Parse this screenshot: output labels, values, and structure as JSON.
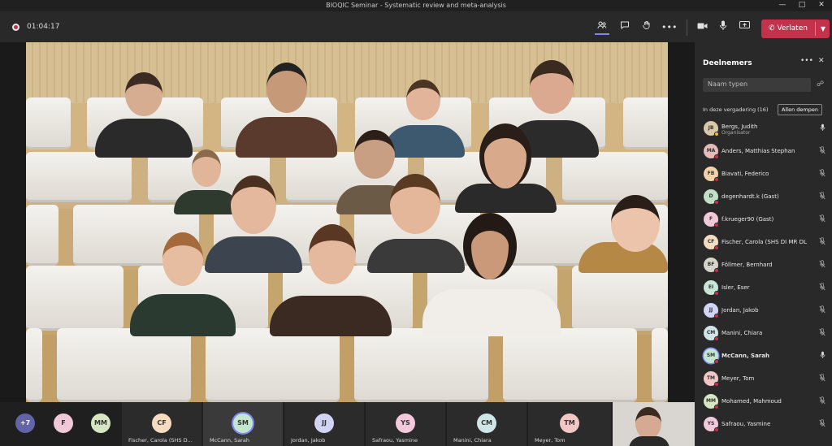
{
  "window": {
    "title": "BIOQIC Seminar - Systematic review and meta-analysis"
  },
  "meeting": {
    "timer": "01:04:17",
    "leave_label": "Verlaten"
  },
  "participants_panel": {
    "title": "Deelnemers",
    "search_placeholder": "Naam typen",
    "section_label": "In deze vergadering (16)",
    "mute_all_label": "Allen dempen",
    "items": [
      {
        "initials": "JB",
        "name": "Bergs, Judith",
        "role": "Organisator",
        "color": "#d9c9a8",
        "mic": "on"
      },
      {
        "initials": "MA",
        "name": "Anders, Matthias Stephan",
        "role": "",
        "color": "#e9b8b8",
        "mic": "off"
      },
      {
        "initials": "FB",
        "name": "Biavati, Federico",
        "role": "",
        "color": "#f3d1a9",
        "mic": "off"
      },
      {
        "initials": "D",
        "name": "degenhardt.k (Gast)",
        "role": "",
        "color": "#bfe0c4",
        "mic": "off"
      },
      {
        "initials": "F",
        "name": "f.krueger90 (Gast)",
        "role": "",
        "color": "#f0c9d9",
        "mic": "off"
      },
      {
        "initials": "CF",
        "name": "Fischer, Carola (SHS DI MR DL...",
        "role": "",
        "color": "#f5dcc0",
        "mic": "off"
      },
      {
        "initials": "BF",
        "name": "Föllmer, Bernhard",
        "role": "",
        "color": "#d5d5c9",
        "mic": "off"
      },
      {
        "initials": "EI",
        "name": "Isler, Eser",
        "role": "",
        "color": "#c6e6d6",
        "mic": "off"
      },
      {
        "initials": "JJ",
        "name": "Jordan, Jakob",
        "role": "",
        "color": "#d1d4f3",
        "mic": "off"
      },
      {
        "initials": "CM",
        "name": "Manini, Chiara",
        "role": "",
        "color": "#cfe6e6",
        "mic": "off"
      },
      {
        "initials": "SM",
        "name": "McCann, Sarah",
        "role": "",
        "color": "#c3e6cf",
        "mic": "on"
      },
      {
        "initials": "TM",
        "name": "Meyer, Tom",
        "role": "",
        "color": "#f3c6c6",
        "mic": "off"
      },
      {
        "initials": "MM",
        "name": "Mohamed, Mahmoud",
        "role": "",
        "color": "#d6e6c3",
        "mic": "off"
      },
      {
        "initials": "YS",
        "name": "Safraou, Yasmine",
        "role": "",
        "color": "#f3c9dc",
        "mic": "off"
      }
    ]
  },
  "strip": {
    "overflow_label": "+7",
    "avatars": [
      {
        "initials": "F",
        "color": "#f0c9d9"
      },
      {
        "initials": "MM",
        "color": "#d6e6c3"
      }
    ],
    "tiles": [
      {
        "initials": "CF",
        "name": "Fischer, Carola (SHS D...",
        "color": "#f5dcc0"
      },
      {
        "initials": "SM",
        "name": "McCann, Sarah",
        "color": "#c3e6cf"
      },
      {
        "initials": "JJ",
        "name": "Jordan, Jakob",
        "color": "#d1d4f3"
      },
      {
        "initials": "YS",
        "name": "Safraou, Yasmine",
        "color": "#f3c9dc"
      },
      {
        "initials": "CM",
        "name": "Manini, Chiara",
        "color": "#cfe6e6"
      },
      {
        "initials": "TM",
        "name": "Meyer, Tom",
        "color": "#f3c6c6"
      }
    ]
  },
  "icons": {
    "participants": "people-icon",
    "chat": "chat-icon",
    "raise_hand": "hand-icon",
    "more": "ellipsis-icon",
    "camera": "camera-icon",
    "microphone": "microphone-icon",
    "share": "share-screen-icon",
    "phone": "phone-hangup-icon"
  },
  "colors": {
    "accent": "#7f85f5",
    "leave": "#c4314b"
  }
}
